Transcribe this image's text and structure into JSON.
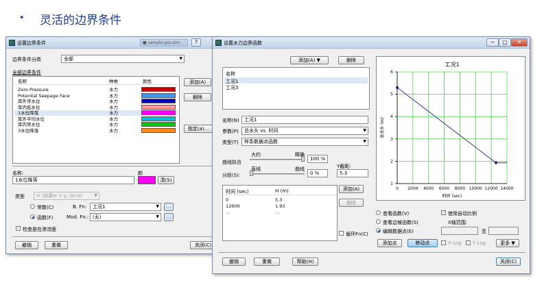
{
  "slide": {
    "bullet": "•",
    "title": "灵活的边界条件"
  },
  "win1": {
    "title": "设置边界条件",
    "bg_tab_title": "■ sample.gsz.sim",
    "help_btn": "?",
    "category_label": "边界条件分类",
    "category_value": "全部",
    "all_bc_label": "全部边界条件",
    "cols": {
      "name": "名称",
      "type": "种类",
      "color": "颜色"
    },
    "rows": [
      {
        "name": "Zero Pressure",
        "type": "水力",
        "color": "#c00000"
      },
      {
        "name": "Potential Seepage Face",
        "type": "水力",
        "color": "#3399ff"
      },
      {
        "name": "库外常水位",
        "type": "水力",
        "color": "#0000cc"
      },
      {
        "name": "库内低水位",
        "type": "水力",
        "color": "#ff9999"
      },
      {
        "name": "1水位降落",
        "type": "水力",
        "color": "#ff00ff"
      },
      {
        "name": "库外平均水位",
        "type": "水力",
        "color": "#00c0e0"
      },
      {
        "name": "库内常水位",
        "type": "水力",
        "color": "#00cc00"
      },
      {
        "name": "3水位降落",
        "type": "水力",
        "color": "#ff8c1a"
      }
    ],
    "add_btn": "添加(A)",
    "delete_btn": "删除",
    "assign_btn": "指定(a)...",
    "name_label": "名称:",
    "name_value": "1水位降落",
    "color_label": "颜",
    "color_swatch": "#ff00ff",
    "color_btn": "淸(S)",
    "kind_label": "类型",
    "kind_value": "H (如果H < y, Q=0)",
    "const_radio": "常数(C)",
    "func_radio": "函数(F)",
    "bfn_label": "B. Fn:",
    "bfn_value": "工况1",
    "modfn_label": "Mod. Fn.:",
    "modfn_value": "(无)",
    "dots_btn": "...",
    "review_chk": "检查是在渗流面",
    "undo_btn": "撤销",
    "redo_btn": "重做",
    "close_btn": "关闭(C)"
  },
  "win2": {
    "title": "设置水力边界函数",
    "add_btn": "添加(A)",
    "delete_btn": "删除",
    "list_header": "名称",
    "list_items": [
      "工况1",
      "工况3"
    ],
    "name_label": "名称(N)",
    "name_value": "工况1",
    "param_label": "参数(P)",
    "param_value": "总水头 vs. 时间",
    "type_label": "类型(T)",
    "type_value": "样条数据点函数",
    "fit_label": "曲线拟合",
    "approx_label": "大约",
    "exact_label": "精确",
    "fit_value": "100 %",
    "segment_label": "分段(S):",
    "straight_label": "直线",
    "curve_label": "曲线",
    "seg_value": "0 %",
    "yintercept_label": "Y截距:",
    "yintercept_value": "5.3",
    "table_cols": {
      "time": "时间 (sec)",
      "head": "H (m)"
    },
    "table_rows": [
      {
        "time": "0",
        "head": "5.3"
      },
      {
        "time": "12600",
        "head": "1.93"
      },
      {
        "time": "...",
        "head": "..."
      }
    ],
    "add_point_btn": "添加(A)",
    "delete_point_btn": "删除",
    "loop_chk": "循环Fn(C)",
    "radio_view": "查看函数(V)",
    "radio_view_bc": "查看边坡函数(S)",
    "radio_edit": "编辑数据点(E)",
    "auto_scale_chk": "使用自动比例",
    "x_range_label": "X轴范围:",
    "to_label": "至",
    "add_pt_btn": "添加点",
    "move_pt_btn": "移动点",
    "xlog_chk": "X Log",
    "ylog_chk": "Y Log",
    "more_btn": "更多",
    "undo_btn": "撤销",
    "redo_btn": "重做",
    "help_btn": "帮助(H)",
    "close_btn": "关闭(C)",
    "win_min": "─",
    "win_max": "□",
    "win_close": "✕"
  },
  "chart_data": {
    "type": "line",
    "title": "工况1",
    "xlabel": "时间 (sec)",
    "ylabel": "总水头 (m)",
    "xlim": [
      0,
      14000
    ],
    "ylim": [
      1,
      6
    ],
    "xticks": [
      "0",
      "2000",
      "4000",
      "6000",
      "8000",
      "10000",
      "12000",
      "14000"
    ],
    "yticks": [
      "1",
      "2",
      "3",
      "4",
      "5",
      "6"
    ],
    "grid": true,
    "series": [
      {
        "points": [
          [
            0,
            5.3
          ],
          [
            12600,
            1.93
          ],
          [
            14000,
            1.93
          ]
        ],
        "color": "#1a1a80"
      }
    ],
    "markers": [
      [
        0,
        5.3
      ],
      [
        12600,
        1.93
      ]
    ]
  }
}
